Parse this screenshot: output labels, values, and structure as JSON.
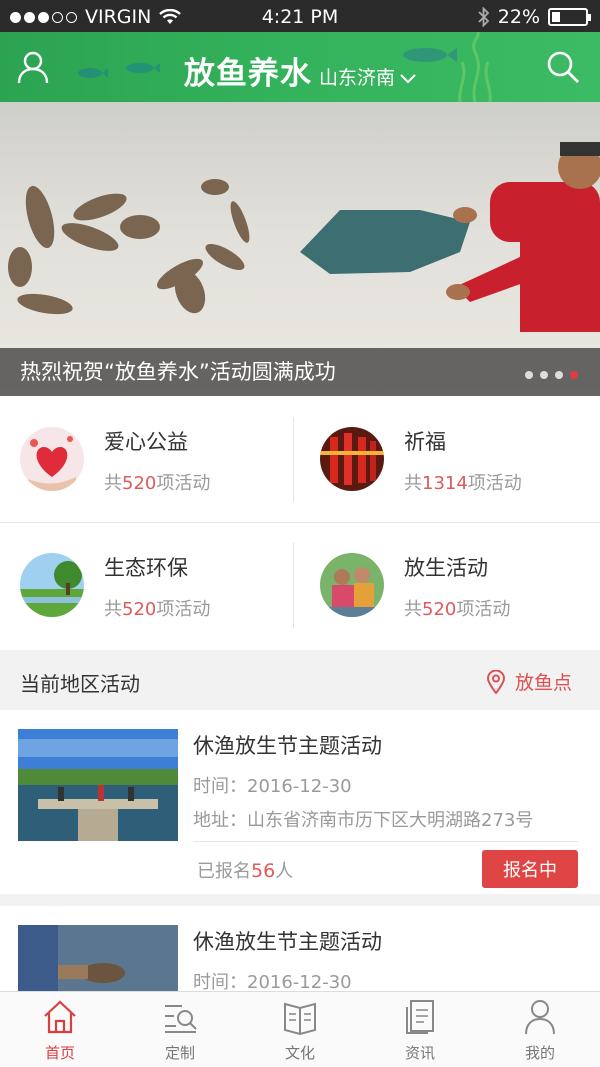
{
  "status_bar": {
    "carrier": "VIRGIN",
    "time": "4:21 PM",
    "battery": "22%",
    "battery_level": 0.22
  },
  "header": {
    "title": "放鱼养水",
    "city": "山东济南",
    "icons": [
      "user-icon",
      "search-icon",
      "chevron-down-icon"
    ]
  },
  "banner": {
    "caption": "热烈祝贺“放鱼养水”活动圆满成功",
    "slide_count": 4,
    "active_slide": 4
  },
  "categories": [
    {
      "name": "爱心公益",
      "count_prefix": "共",
      "count": "520",
      "count_suffix": "项活动"
    },
    {
      "name": "祈福",
      "count_prefix": "共",
      "count": "1314",
      "count_suffix": "项活动"
    },
    {
      "name": "生态环保",
      "count_prefix": "共",
      "count": "520",
      "count_suffix": "项活动"
    },
    {
      "name": "放生活动",
      "count_prefix": "共",
      "count": "520",
      "count_suffix": "项活动"
    }
  ],
  "section": {
    "title": "当前地区活动",
    "spot_label": "放鱼点"
  },
  "events": [
    {
      "name": "休渔放生节主题活动",
      "time": "时间：2016-12-30",
      "address": "地址：山东省济南市历下区大明湖路273号",
      "enrolled_prefix": "已报名",
      "enrolled_count": "56",
      "enrolled_suffix": "人",
      "button": "报名中"
    },
    {
      "name": "休渔放生节主题活动",
      "time": "时间：2016-12-30"
    }
  ],
  "tabbar": [
    {
      "label": "首页",
      "icon": "home-icon",
      "active": true
    },
    {
      "label": "定制",
      "icon": "customize-icon",
      "active": false
    },
    {
      "label": "文化",
      "icon": "book-icon",
      "active": false
    },
    {
      "label": "资讯",
      "icon": "news-icon",
      "active": false
    },
    {
      "label": "我的",
      "icon": "profile-icon",
      "active": false
    }
  ],
  "colors": {
    "brand_green": "#33b15b",
    "accent_red": "#df4545"
  }
}
